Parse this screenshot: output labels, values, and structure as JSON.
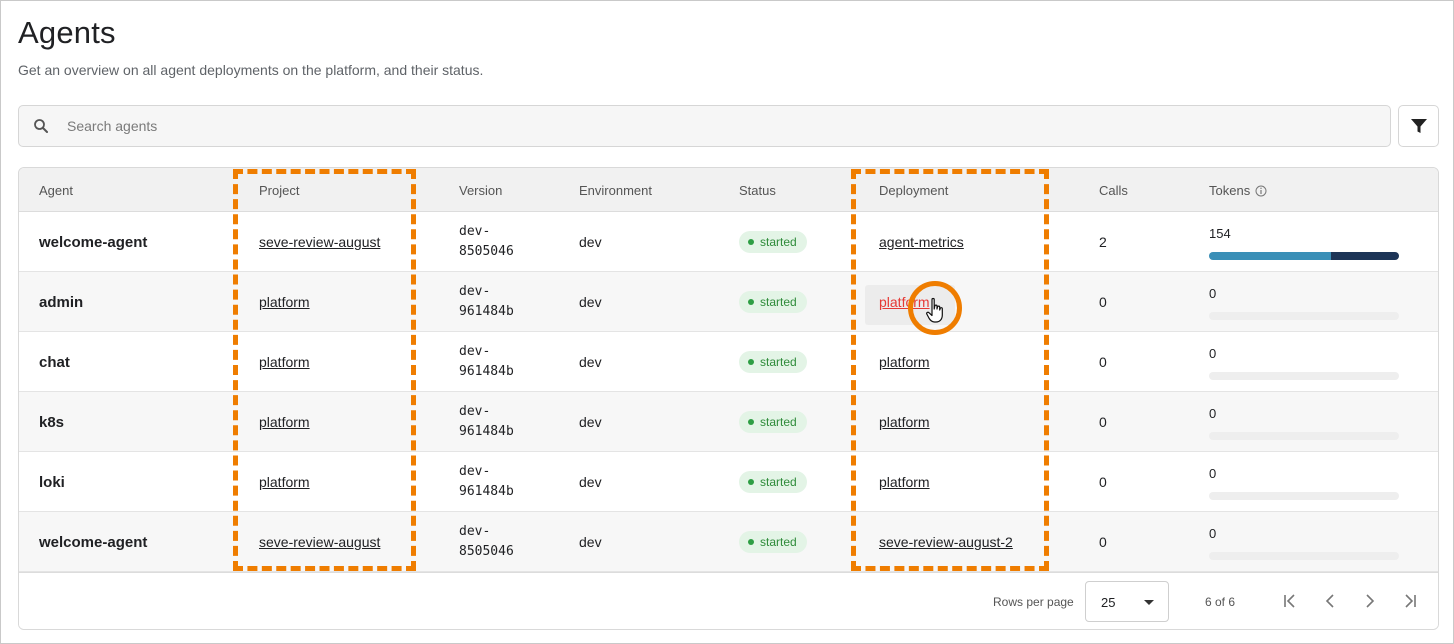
{
  "header": {
    "title": "Agents",
    "subtitle": "Get an overview on all agent deployments on the platform, and their status."
  },
  "search": {
    "placeholder": "Search agents",
    "icon": "search-icon"
  },
  "filter": {
    "icon": "filter-icon"
  },
  "table": {
    "columns": {
      "agent": "Agent",
      "project": "Project",
      "version": "Version",
      "environment": "Environment",
      "status": "Status",
      "deployment": "Deployment",
      "calls": "Calls",
      "tokens": "Tokens"
    },
    "rows": [
      {
        "agent": "welcome-agent",
        "project": "seve-review-august",
        "version_line1": "dev-",
        "version_line2": "8505046",
        "environment": "dev",
        "status": "started",
        "deployment": "agent-metrics",
        "calls": "2",
        "tokens": "154"
      },
      {
        "agent": "admin",
        "project": "platform",
        "version_line1": "dev-",
        "version_line2": "961484b",
        "environment": "dev",
        "status": "started",
        "deployment": "platform",
        "calls": "0",
        "tokens": "0"
      },
      {
        "agent": "chat",
        "project": "platform",
        "version_line1": "dev-",
        "version_line2": "961484b",
        "environment": "dev",
        "status": "started",
        "deployment": "platform",
        "calls": "0",
        "tokens": "0"
      },
      {
        "agent": "k8s",
        "project": "platform",
        "version_line1": "dev-",
        "version_line2": "961484b",
        "environment": "dev",
        "status": "started",
        "deployment": "platform",
        "calls": "0",
        "tokens": "0"
      },
      {
        "agent": "loki",
        "project": "platform",
        "version_line1": "dev-",
        "version_line2": "961484b",
        "environment": "dev",
        "status": "started",
        "deployment": "platform",
        "calls": "0",
        "tokens": "0"
      },
      {
        "agent": "welcome-agent",
        "project": "seve-review-august",
        "version_line1": "dev-",
        "version_line2": "8505046",
        "environment": "dev",
        "status": "started",
        "deployment": "seve-review-august-2",
        "calls": "0",
        "tokens": "0"
      }
    ],
    "token_bar_first_row": {
      "segment_a_fraction": 0.64,
      "segment_b_fraction": 0.36,
      "color_a": "#3a8fb7",
      "color_b": "#1d3557"
    }
  },
  "footer": {
    "rows_per_page_label": "Rows per page",
    "rows_per_page_value": "25",
    "page_count": "6 of 6"
  },
  "colors": {
    "annotation": "#ef7d00",
    "status_bg": "#e3f4e6",
    "status_text": "#2e8b3a",
    "hover_link": "#e53935"
  }
}
